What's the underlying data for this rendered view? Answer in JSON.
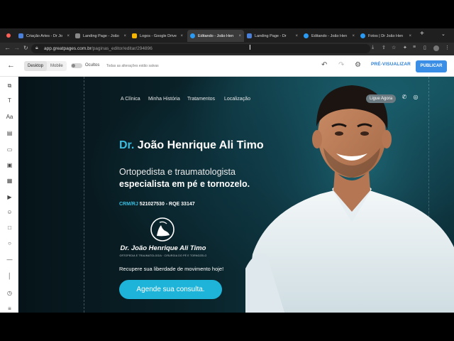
{
  "browser": {
    "tabs": [
      {
        "label": "Criação Artes - Dr Jo",
        "favicon": "#4a7fd9"
      },
      {
        "label": "Landing Page - João",
        "favicon": "#888888"
      },
      {
        "label": "Landing Page - Jo",
        "favicon": "#4a7fd9"
      },
      {
        "label": "Logos - Google Drive",
        "favicon": "#f4b400"
      },
      {
        "label": "Editando - João Hen",
        "favicon": "#2b9af3",
        "active": true
      },
      {
        "label": "Landing Page - Dr",
        "favicon": "#4a7fd9"
      },
      {
        "label": "Editando - João Hen",
        "favicon": "#2b9af3"
      },
      {
        "label": "Fotos | Dr João Hen",
        "favicon": "#2b9af3"
      }
    ],
    "new_tab": "+",
    "url_host": "app.greatpages.com.br",
    "url_path": "/paginas_editor/editar/294896"
  },
  "editor": {
    "device_desktop": "Desktop",
    "device_mobile": "Mobile",
    "hidden_label": "Ocultos",
    "save_status": "Todas as alterações estão salvas",
    "preview_label": "PRÉ-VISUALIZAR",
    "publish_label": "PUBLICAR"
  },
  "page": {
    "menu": [
      "A Clínica",
      "Minha História",
      "Tratamentos",
      "Localização"
    ],
    "contact_button": "Ligue Agora",
    "title_prefix": "Dr.",
    "title_name": "João Henrique Ali Timo",
    "subtitle_line1": "Ortopedista e traumatologista",
    "subtitle_line2": "especialista em pé e tornozelo.",
    "crm_label": "CRM/RJ",
    "crm_value": "521027530 - RQE 33147",
    "logo_name": "Dr. João Henrique Ali Timo",
    "logo_tagline": "ORTOPEDIA E TRAUMATOLOGIA · CIRURGIA DO PÉ E TORNOZELO",
    "tagline": "Recupere sua liberdade de movimento hoje!",
    "cta": "Agende sua consulta.",
    "accent_color": "#1eb3d9"
  }
}
